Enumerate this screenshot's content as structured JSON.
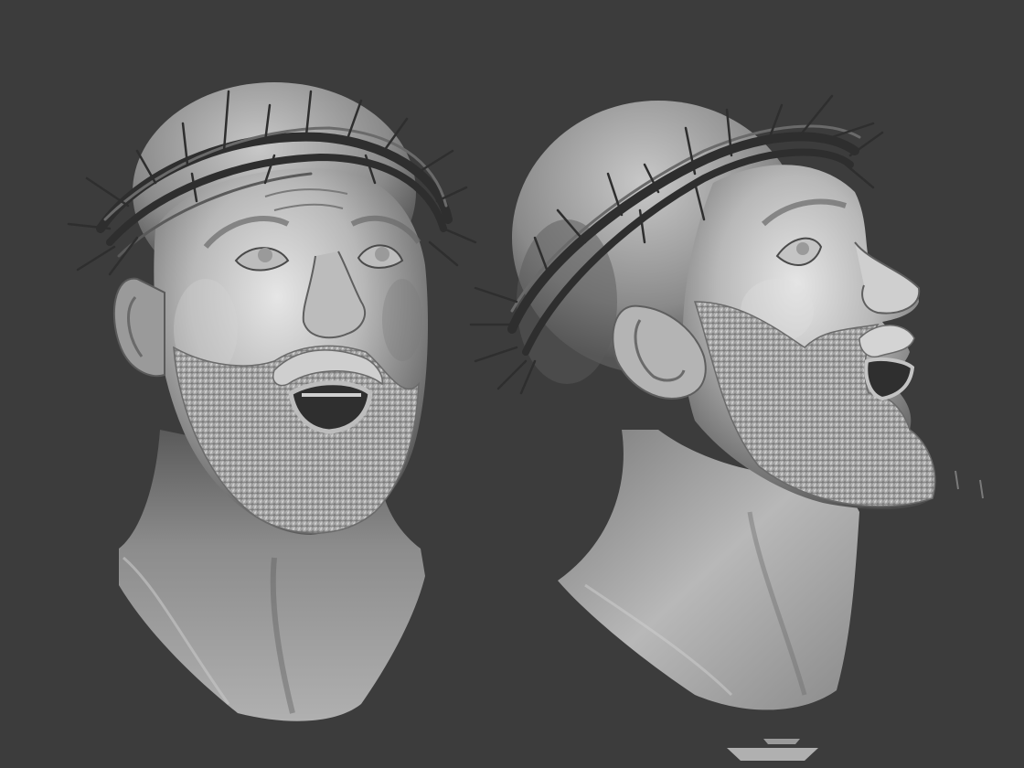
{
  "scene": {
    "background_color": "#3c3c3c",
    "clay_light": "#d9d9d9",
    "clay_mid": "#9c9c9c",
    "clay_dark": "#4a4a4a",
    "thorn_color": "#2e2e2e",
    "subjects": [
      {
        "name": "sculpted-head-front-view",
        "icon": "clay-bust"
      },
      {
        "name": "sculpted-head-side-view",
        "icon": "clay-bust"
      }
    ]
  }
}
